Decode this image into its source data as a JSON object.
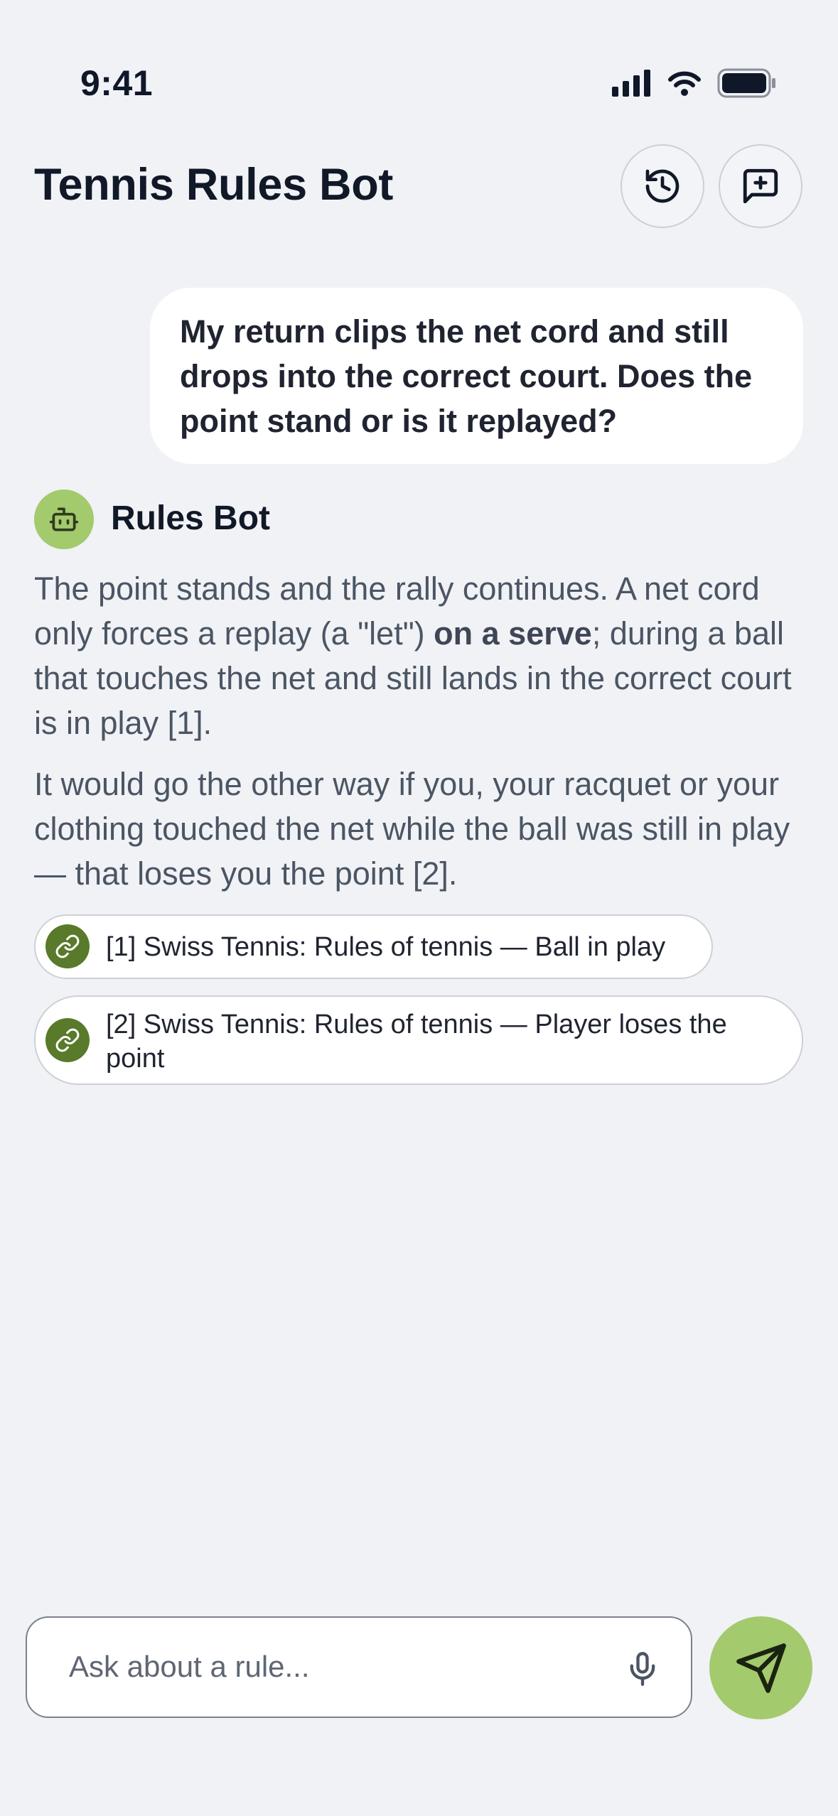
{
  "status_bar": {
    "time": "9:41"
  },
  "header": {
    "title": "Tennis Rules Bot",
    "icons": [
      "history-icon",
      "new-chat-icon"
    ]
  },
  "conversation": {
    "user_message": "My return clips the net cord and still drops into the correct court. Does the point stand or is it replayed?",
    "bot": {
      "name": "Rules Bot",
      "avatar_icon": "robot-icon",
      "paragraph_1": {
        "before_bold": "The point stands and the rally continues. A net cord only forces a replay (a \"let\") ",
        "bold": "on a serve",
        "after_bold": "; during a ball that touches the net and still lands in the correct court is in play [1]."
      },
      "paragraph_2": "It would go the other way if you, your racquet or your clothing touched the net while the ball was still in play — that loses you the point [2].",
      "sources": [
        {
          "label": "[1] Swiss Tennis: Rules of tennis — Ball in play",
          "icon": "link-icon"
        },
        {
          "label": "[2] Swiss Tennis: Rules of tennis — Player loses the point",
          "icon": "link-icon"
        }
      ]
    }
  },
  "composer": {
    "placeholder": "Ask about a rule...",
    "mic_icon": "microphone-icon",
    "send_icon": "send-icon"
  },
  "colors": {
    "background": "#f0f2f6",
    "accent_green": "#a3ca6c",
    "chip_icon_green": "#587a2a",
    "title_text": "#111827",
    "body_text": "#4b5563"
  }
}
